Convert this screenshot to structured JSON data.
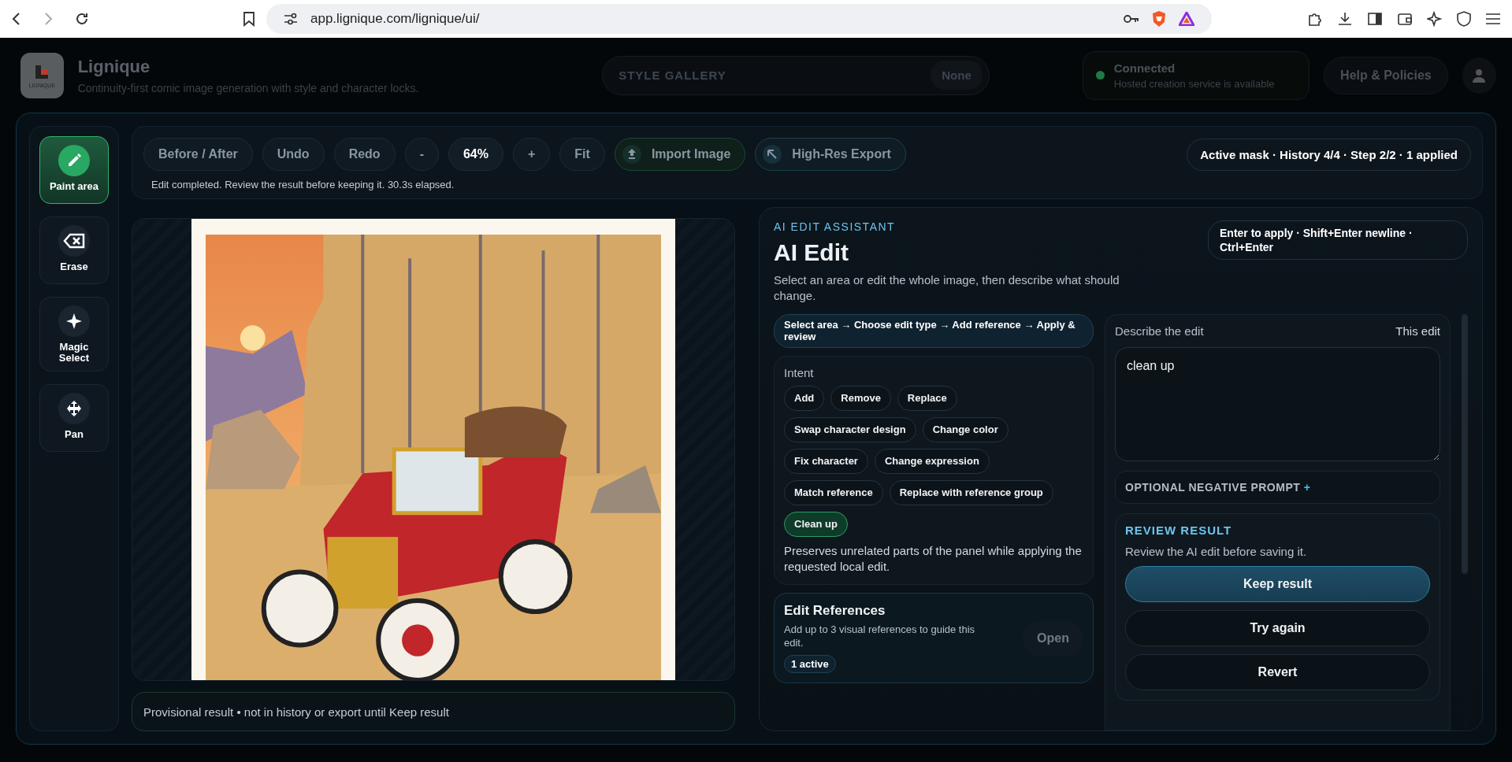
{
  "browser": {
    "url": "app.lignique.com/lignique/ui/"
  },
  "header": {
    "brand": {
      "name": "Lignique",
      "tagline": "Continuity-first comic image generation with style and character locks.",
      "logo_text": "LIGNIQUE"
    },
    "style_gallery": {
      "label": "STYLE GALLERY",
      "value": "None"
    },
    "connection": {
      "online": true,
      "title": "Connected",
      "detail": "Hosted creation service is available"
    },
    "help": "Help & Policies"
  },
  "tools": [
    {
      "kind": "paint",
      "label": "Paint area",
      "selected": true
    },
    {
      "kind": "erase",
      "label": "Erase",
      "selected": false
    },
    {
      "kind": "magic",
      "label": "Magic Select",
      "selected": false
    },
    {
      "kind": "pan",
      "label": "Pan",
      "selected": false
    }
  ],
  "toolbar": {
    "buttons": [
      {
        "kind": "plain",
        "label": "Before / After"
      },
      {
        "kind": "plain",
        "label": "Undo"
      },
      {
        "kind": "plain",
        "label": "Redo"
      },
      {
        "kind": "plain",
        "label": "-"
      },
      {
        "kind": "readout",
        "label": "64%"
      },
      {
        "kind": "plain",
        "label": "+"
      },
      {
        "kind": "plain",
        "label": "Fit"
      },
      {
        "kind": "import",
        "label": "Import Image"
      },
      {
        "kind": "export",
        "label": "High-Res Export"
      }
    ],
    "status": "Active mask · History 4/4 · Step 2/2 · 1 applied",
    "message": "Edit completed. Review the result before keeping it. 30.3s elapsed."
  },
  "canvas": {
    "note": "Provisional result • not in history or export until Keep result"
  },
  "assistant": {
    "eyebrow": "AI EDIT ASSISTANT",
    "title": "AI Edit",
    "description": "Select an area or edit the whole image, then describe what should change.",
    "hint": "Enter to apply · Shift+Enter newline · Ctrl+Enter",
    "steps": "Select area → Choose edit type → Add reference → Apply & review",
    "intent": {
      "label": "Intent",
      "options": [
        {
          "label": "Add",
          "selected": false
        },
        {
          "label": "Remove",
          "selected": false
        },
        {
          "label": "Replace",
          "selected": false
        },
        {
          "label": "Swap character design",
          "selected": false
        },
        {
          "label": "Change color",
          "selected": false
        },
        {
          "label": "Fix character",
          "selected": false
        },
        {
          "label": "Change expression",
          "selected": false
        },
        {
          "label": "Match reference",
          "selected": false
        },
        {
          "label": "Replace with reference group",
          "selected": false
        },
        {
          "label": "Clean up",
          "selected": true
        }
      ],
      "description": "Preserves unrelated parts of the panel while applying the requested local edit."
    },
    "references": {
      "title": "Edit References",
      "description": "Add up to 3 visual references to guide this edit.",
      "open": "Open",
      "badge": "1 active"
    },
    "prompt": {
      "label": "Describe the edit",
      "scope": "This edit",
      "value": "clean up"
    },
    "negative": {
      "label": "OPTIONAL NEGATIVE PROMPT",
      "toggle": "+"
    },
    "review": {
      "title": "REVIEW RESULT",
      "description": "Review the AI edit before saving it.",
      "buttons": [
        {
          "kind": "primary",
          "label": "Keep result"
        },
        {
          "kind": "secondary",
          "label": "Try again"
        },
        {
          "kind": "secondary",
          "label": "Revert"
        }
      ]
    }
  }
}
